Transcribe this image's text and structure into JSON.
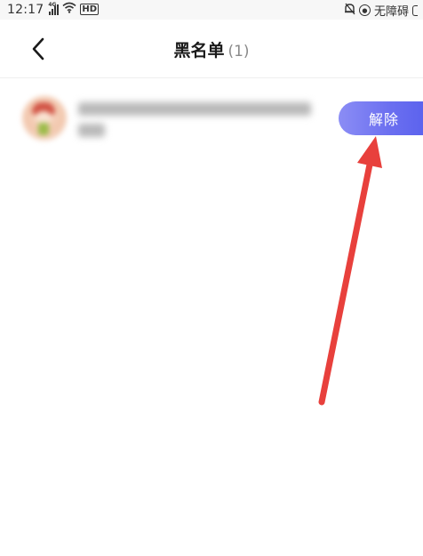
{
  "status_bar": {
    "time": "12:17",
    "signal_tag": "4G",
    "hd_label": "HD",
    "accessibility_label": "无障碍"
  },
  "navbar": {
    "title": "黑名单",
    "count": "(1)"
  },
  "blacklist": {
    "items": [
      {
        "unblock_label": "解除"
      }
    ]
  },
  "colors": {
    "button_gradient_start": "#8b8df5",
    "button_gradient_end": "#5c63ee",
    "annotation_arrow": "#e8403c"
  },
  "icons": {
    "back": "chevron-left-icon",
    "signal": "signal-icon",
    "wifi": "wifi-icon",
    "alarm": "alarm-icon",
    "lock_rotation": "rotation-lock-icon",
    "battery": "battery-icon"
  }
}
